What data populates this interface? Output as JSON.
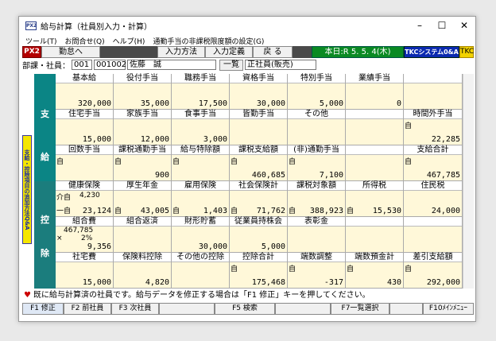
{
  "window": {
    "icon": "PX2",
    "title": "給与計算（社員別入力・計算）",
    "minimize": "–",
    "maximize": "☐",
    "close": "✕"
  },
  "menu": [
    "ツール(T)",
    "お問合せ(Q)",
    "ヘルプ(H)",
    "通勤手当の非課税限度額の設定(G)"
  ],
  "toolbar": {
    "px2": "PX2",
    "kintai": "勤怠へ",
    "input_method": "入力方法",
    "input_def": "入力定義",
    "back": "戻 る",
    "today": "本日:R 5. 5. 4(木)",
    "tkc": "TKCシステム0&A",
    "tkc_icon": "TKC"
  },
  "employee": {
    "label": "部課・社員：",
    "dept": "001",
    "code": "001002",
    "name": "佐藤　誠",
    "list_btn": "一覧",
    "type": "正社員(販売)"
  },
  "sidebar_text": "支給・控除項目の追加方法Q&A",
  "bands": {
    "shi": "支",
    "kyu": "給",
    "kou": "控",
    "jo": "除"
  },
  "pay": [
    [
      {
        "l": "基本給",
        "v": "320,000"
      },
      {
        "l": "役付手当",
        "v": "35,000"
      },
      {
        "l": "職務手当",
        "v": "17,500"
      },
      {
        "l": "資格手当",
        "v": "30,000"
      },
      {
        "l": "特別手当",
        "v": "5,000"
      },
      {
        "l": "業績手当",
        "v": "0"
      },
      {
        "l": "",
        "v": ""
      }
    ],
    [
      {
        "l": "住宅手当",
        "v": "15,000"
      },
      {
        "l": "家族手当",
        "v": "12,000"
      },
      {
        "l": "食事手当",
        "v": "3,000"
      },
      {
        "l": "皆勤手当",
        "v": ""
      },
      {
        "l": "その他",
        "v": ""
      },
      {
        "l": "",
        "v": ""
      },
      {
        "l": "時間外手当",
        "v": "22,285",
        "m": "自"
      }
    ],
    [
      {
        "l": "回数手当",
        "v": "",
        "m": "自"
      },
      {
        "l": "課税通勤手当",
        "v": "900",
        "m": "自"
      },
      {
        "l": "給与特除額",
        "v": "",
        "m": "自"
      },
      {
        "l": "課税支給額",
        "v": "460,685",
        "m": "自"
      },
      {
        "l": "(非)通勤手当",
        "v": "7,100",
        "m": "自"
      },
      {
        "l": "",
        "v": ""
      },
      {
        "l": "支給合計",
        "v": "467,785",
        "m": "自"
      }
    ]
  ],
  "ded": [
    [
      {
        "l": "健康保険",
        "v": "23,124",
        "s1": "介自",
        "s1v": "4,230",
        "s2": "一自"
      },
      {
        "l": "厚生年金",
        "v": "43,005",
        "m2": "自"
      },
      {
        "l": "雇用保険",
        "v": "1,403",
        "m2": "自"
      },
      {
        "l": "社会保険計",
        "v": "71,762",
        "m2": "自"
      },
      {
        "l": "課税対象額",
        "v": "388,923",
        "m2": "自"
      },
      {
        "l": "所得税",
        "v": "15,530",
        "m2": "自"
      },
      {
        "l": "住民税",
        "v": "24,000"
      }
    ],
    [
      {
        "l": "組合費",
        "v": "9,356",
        "x": "×",
        "x1": "467,785",
        "x2": "2%"
      },
      {
        "l": "組合返済",
        "v": ""
      },
      {
        "l": "財形貯蓄",
        "v": "30,000"
      },
      {
        "l": "従業員持株会",
        "v": "5,000"
      },
      {
        "l": "表彰金",
        "v": ""
      },
      {
        "l": "",
        "v": ""
      },
      {
        "l": "",
        "v": ""
      }
    ],
    [
      {
        "l": "社宅費",
        "v": "15,000"
      },
      {
        "l": "保険料控除",
        "v": "4,820"
      },
      {
        "l": "その他の控除",
        "v": ""
      },
      {
        "l": "控除合計",
        "v": "175,468",
        "m": "自"
      },
      {
        "l": "端数調整",
        "v": "-317",
        "m": "自"
      },
      {
        "l": "端数預金計",
        "v": "430",
        "m": "自"
      },
      {
        "l": "差引支給額",
        "v": "292,000",
        "m": "自"
      }
    ]
  ],
  "status": "既に給与計算済の社員です。給与データを修正する場合は「F1 修正」キーを押してください。",
  "fkeys": {
    "f1": "F1 修正",
    "f2": "F2 前社員",
    "f3": "F3 次社員",
    "f5": "F5 検索",
    "f7": "F7一覧選択",
    "f10": "F10ﾒｲﾝﾒﾆｭｰ"
  }
}
